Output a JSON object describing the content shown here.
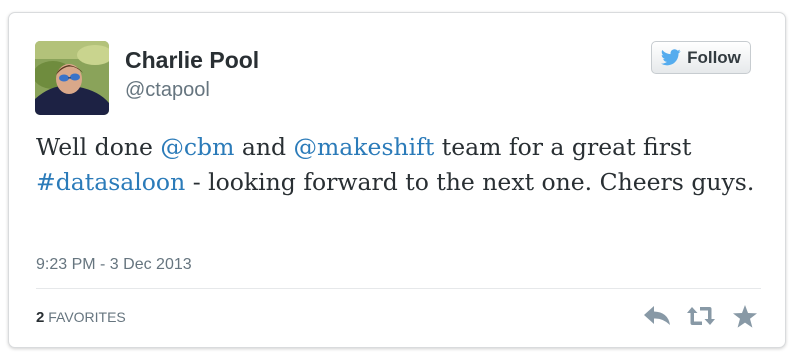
{
  "author": {
    "name": "Charlie Pool",
    "handle": "@ctapool"
  },
  "follow_button": {
    "label": "Follow",
    "icon": "twitter-bird-icon"
  },
  "tweet": {
    "segments": [
      {
        "text": "Well done ",
        "link": false
      },
      {
        "text": "@cbm",
        "link": true
      },
      {
        "text": " and ",
        "link": false
      },
      {
        "text": "@makeshift",
        "link": true
      },
      {
        "text": " team for a great first ",
        "link": false
      },
      {
        "text": "#datasaloon",
        "link": true
      },
      {
        "text": " - looking forward to the next one. Cheers guys.",
        "link": false
      }
    ]
  },
  "timestamp": "9:23 PM - 3 Dec 2013",
  "stats": {
    "favorites_count": "2",
    "favorites_label": "FAVORITES"
  },
  "actions": [
    {
      "name": "reply",
      "icon": "reply-icon"
    },
    {
      "name": "retweet",
      "icon": "retweet-icon"
    },
    {
      "name": "favorite",
      "icon": "star-icon"
    }
  ],
  "colors": {
    "link": "#2b7bb9",
    "text": "#292f33",
    "secondary": "#66757f",
    "twitter_blue": "#55acee",
    "action_icon": "#8899a6"
  }
}
